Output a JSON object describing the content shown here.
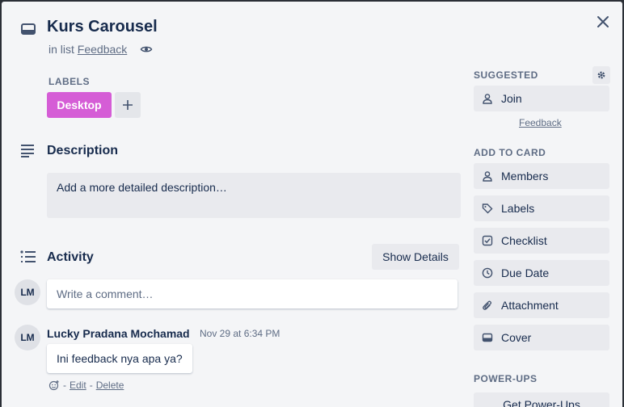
{
  "card": {
    "title": "Kurs Carousel",
    "in_list_prefix": "in list",
    "list_name": "Feedback"
  },
  "labels": {
    "heading": "Labels",
    "items": [
      {
        "name": "Desktop",
        "color": "#d55dd6"
      }
    ]
  },
  "description": {
    "heading": "Description",
    "placeholder": "Add a more detailed description…"
  },
  "activity": {
    "heading": "Activity",
    "show_details_label": "Show Details",
    "comment_placeholder": "Write a comment…",
    "current_user_initials": "LM",
    "comments": [
      {
        "initials": "LM",
        "author": "Lucky Pradana Mochamad",
        "timestamp": "Nov 29 at 6:34 PM",
        "text": "Ini feedback nya apa ya?",
        "sep1": "-",
        "edit_label": "Edit",
        "sep2": "-",
        "delete_label": "Delete"
      }
    ]
  },
  "sidebar": {
    "suggested_heading": "Suggested",
    "join_label": "Join",
    "feedback_link": "Feedback",
    "add_to_card_heading": "Add to card",
    "add_to_card": [
      {
        "label": "Members",
        "icon": "person-icon"
      },
      {
        "label": "Labels",
        "icon": "tag-icon"
      },
      {
        "label": "Checklist",
        "icon": "checkbox-icon"
      },
      {
        "label": "Due Date",
        "icon": "clock-icon"
      },
      {
        "label": "Attachment",
        "icon": "paperclip-icon"
      },
      {
        "label": "Cover",
        "icon": "cover-icon"
      }
    ],
    "power_ups_heading": "Power-Ups",
    "get_power_ups_label": "Get Power-Ups"
  }
}
